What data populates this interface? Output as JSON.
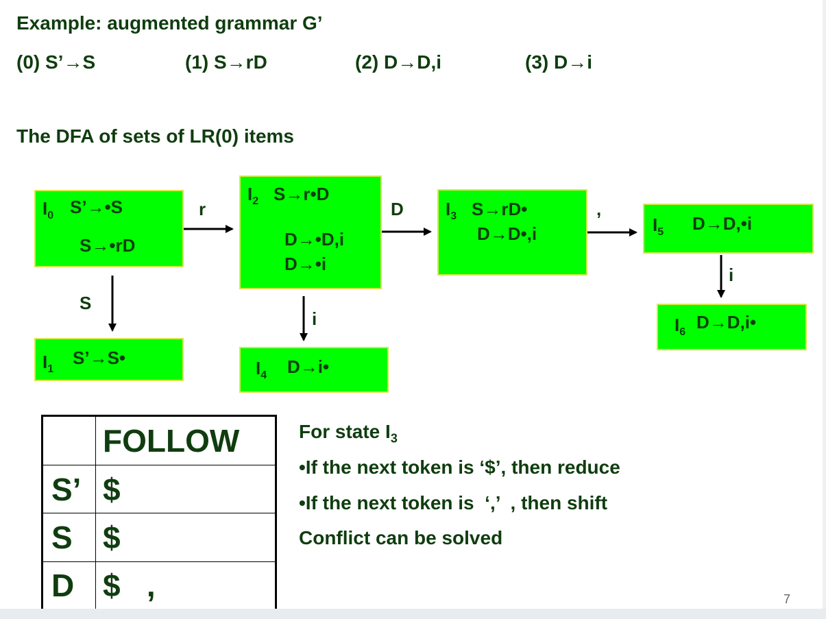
{
  "title": "Example: augmented grammar G’",
  "productions": [
    "(0)  S’→S",
    "(1)  S→rD",
    "(2)  D→D,i",
    "(3)  D→i"
  ],
  "subtitle": "The DFA of sets of LR(0) items",
  "states": {
    "I0": {
      "name": "I",
      "sub": "0",
      "items": [
        "S’→•S",
        "S→•rD"
      ]
    },
    "I1": {
      "name": "I",
      "sub": "1",
      "items": [
        "S’→S•"
      ]
    },
    "I2": {
      "name": "I",
      "sub": "2",
      "items": [
        "S→r•D",
        "D→•D,i",
        "D→•i"
      ]
    },
    "I3": {
      "name": "I",
      "sub": "3",
      "items": [
        "S→rD•",
        "D→D•,i"
      ]
    },
    "I4": {
      "name": "I",
      "sub": "4",
      "items": [
        "D→i•"
      ]
    },
    "I5": {
      "name": "I",
      "sub": "5",
      "items": [
        "D→D,•i"
      ]
    },
    "I6": {
      "name": "I",
      "sub": "6",
      "items": [
        "D→D,i•"
      ]
    }
  },
  "transitions": {
    "I0_I2": "r",
    "I0_I1": "S",
    "I2_I3": "D",
    "I2_I4": "i",
    "I3_I5": ",",
    "I5_I6": "i"
  },
  "follow_table": {
    "header": "FOLLOW",
    "rows": [
      {
        "symbol": "S’",
        "follow": "$"
      },
      {
        "symbol": "S",
        "follow": "$"
      },
      {
        "symbol": "D",
        "follow": "$   ,"
      }
    ]
  },
  "explanation": {
    "heading": "For state I",
    "heading_sub": "3",
    "lines": [
      "•If the next token is ‘$’, then reduce",
      "•If the next token is  ‘,’  , then shift",
      "Conflict can be solved"
    ]
  },
  "page_number": "7",
  "colors": {
    "state_fill": "#00ff00",
    "state_border": "#d6e84a",
    "text": "#0f3d0f"
  }
}
